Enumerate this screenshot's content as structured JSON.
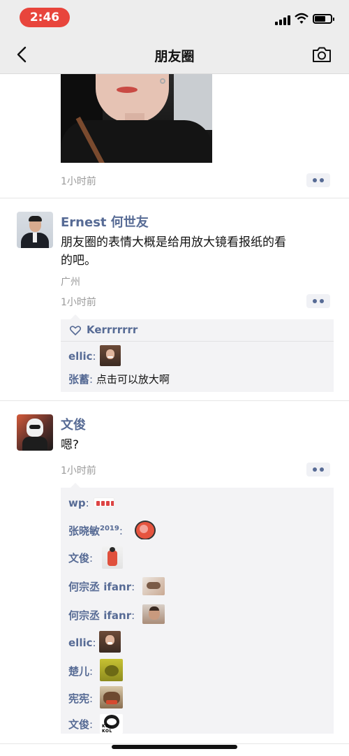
{
  "status_bar": {
    "time": "2:46"
  },
  "nav": {
    "title": "朋友圈"
  },
  "posts": [
    {
      "time": "1小时前"
    },
    {
      "author": "Ernest 何世友",
      "text_line1": "朋友圈的表情大概是给用放大镜看报纸的看",
      "text_line2": "的吧。",
      "location": "广州",
      "time": "1小时前",
      "likes": [
        "Kerrrrrrr"
      ],
      "comments": [
        {
          "name": "ellic",
          "text": ""
        },
        {
          "name": "张蓄",
          "text": "点击可以放大啊"
        }
      ]
    },
    {
      "author": "文俊",
      "text": "嗯?",
      "time": "1小时前",
      "comments": [
        {
          "name": "wp"
        },
        {
          "name": "张晓敏",
          "sup": "2019"
        },
        {
          "name": "文俊"
        },
        {
          "name": "何宗丞 ifanr"
        },
        {
          "name": "何宗丞 ifanr"
        },
        {
          "name": "ellic"
        },
        {
          "name": "楚儿"
        },
        {
          "name": "宪宪"
        },
        {
          "name": "文俊",
          "sticker_text": "KOL KOL"
        }
      ]
    }
  ],
  "colors": {
    "link": "#576b95",
    "status_pill": "#e8453c"
  },
  "icons": {
    "back": "chevron-left-icon",
    "camera": "camera-icon",
    "more": "more-dots-icon",
    "like": "heart-outline-icon",
    "signal": "cellular-signal-icon",
    "wifi": "wifi-icon",
    "battery": "battery-icon"
  }
}
